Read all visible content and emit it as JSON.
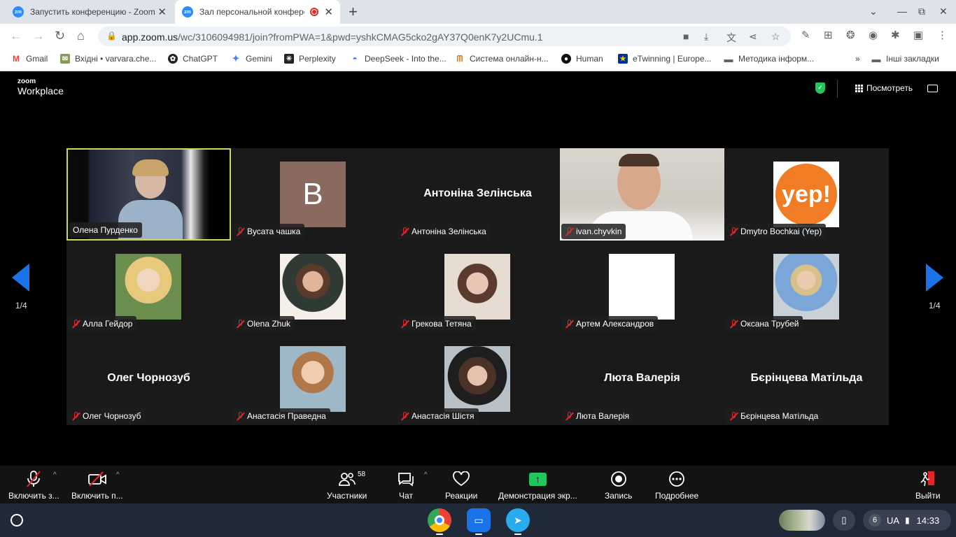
{
  "browser": {
    "tabs": [
      {
        "title": "Запустить конференцию - Zoom"
      },
      {
        "title": "Зал персональной конференции"
      }
    ],
    "new_tab": "+",
    "url_host": "app.zoom.us",
    "url_rest": "/wc/3106094981/join?fromPWA=1&pwd=yshkCMAG5cko2gAY37Q0enK7y2UCmu.1",
    "bookmarks": [
      "Gmail",
      "Вхідні • varvara.che...",
      "ChatGPT",
      "Gemini",
      "Perplexity",
      "DeepSeek - Into the...",
      "Система онлайн-н...",
      "Human",
      "eTwinning | Europe...",
      "Методика інформ..."
    ],
    "bookmarks_overflow": "»",
    "other_bookmarks": "Інші закладки"
  },
  "zoom": {
    "logo_small": "zoom",
    "logo_big": "Workplace",
    "view_label": "Посмотреть",
    "page_indicator": "1/4",
    "participants": [
      {
        "name": "Олена Пурденко",
        "muted": false,
        "kind": "video",
        "speaking": true
      },
      {
        "name": "Вусата чашка",
        "muted": true,
        "kind": "letter",
        "letter": "B"
      },
      {
        "name": "Антоніна Зелінська",
        "muted": true,
        "kind": "name"
      },
      {
        "name": "ivan.chyvkin",
        "muted": true,
        "kind": "video"
      },
      {
        "name": "Dmytro Bochkai (Yep)",
        "muted": true,
        "kind": "logo",
        "logo_text": "yep!"
      },
      {
        "name": "Алла Гейдор",
        "muted": true,
        "kind": "photo"
      },
      {
        "name": "Olena Zhuk",
        "muted": true,
        "kind": "photo"
      },
      {
        "name": "Грекова Тетяна",
        "muted": true,
        "kind": "photo"
      },
      {
        "name": "Артем Александров",
        "muted": true,
        "kind": "blank"
      },
      {
        "name": "Оксана Трубей",
        "muted": true,
        "kind": "photo"
      },
      {
        "name": "Олег Чорнозуб",
        "muted": true,
        "kind": "name"
      },
      {
        "name": "Анастасія Праведна",
        "muted": true,
        "kind": "photo"
      },
      {
        "name": "Анастасія Шістя",
        "muted": true,
        "kind": "photo"
      },
      {
        "name": "Люта Валерія",
        "muted": true,
        "kind": "name"
      },
      {
        "name": "Бєрінцева Матільда",
        "muted": true,
        "kind": "name"
      }
    ],
    "toolbar": {
      "audio": "Включить з...",
      "video": "Включить п...",
      "participants": "Участники",
      "participants_count": "58",
      "chat": "Чат",
      "reactions": "Реакции",
      "share": "Демонстрация экр...",
      "record": "Запись",
      "more": "Подробнее",
      "leave": "Выйти"
    }
  },
  "shelf": {
    "notifications": "6",
    "lang": "UA",
    "time": "14:33"
  },
  "colors": {
    "accent": "#1a73e8",
    "mute_red": "#e02828",
    "speaker_border": "#c8d95a",
    "share_green": "#22c55e"
  }
}
